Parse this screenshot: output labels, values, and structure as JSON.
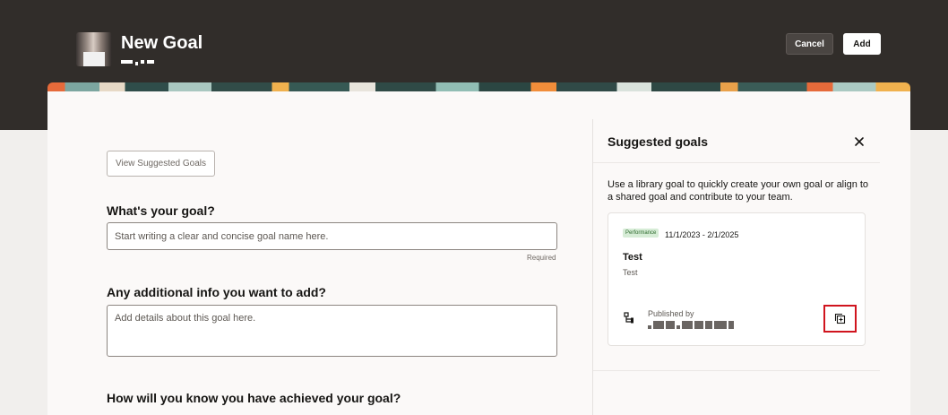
{
  "header": {
    "title": "New Goal",
    "cancel_label": "Cancel",
    "add_label": "Add"
  },
  "form": {
    "view_suggested_label": "View Suggested Goals",
    "goal_label": "What's your goal?",
    "goal_placeholder": "Start writing a clear and concise goal name here.",
    "required_text": "Required",
    "info_label": "Any additional info you want to add?",
    "info_placeholder": "Add details about this goal here.",
    "achieved_label": "How will you know you have achieved your goal?"
  },
  "panel": {
    "title": "Suggested goals",
    "description": "Use a library goal to quickly create your own goal or align to a shared goal and contribute to your team.",
    "goal": {
      "badge": "Performance",
      "dates": "11/1/2023 - 2/1/2025",
      "name": "Test",
      "description": "Test",
      "published_by_label": "Published by"
    }
  },
  "icons": {
    "close": "close-icon",
    "hierarchy": "hierarchy-icon",
    "add_goal": "add-copy-icon"
  },
  "colors": {
    "header_bg": "#312d2a",
    "highlight_border": "#d0141e",
    "badge_bg": "#d6ecd6"
  }
}
